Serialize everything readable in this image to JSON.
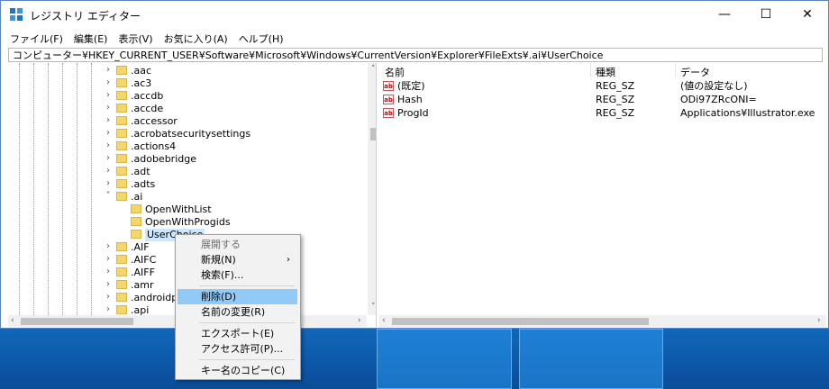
{
  "window": {
    "title": "レジストリ エディター",
    "minimize": "—",
    "maximize": "☐",
    "close": "✕"
  },
  "menu": [
    "ファイル(F)",
    "編集(E)",
    "表示(V)",
    "お気に入り(A)",
    "ヘルプ(H)"
  ],
  "address": "コンピューター¥HKEY_CURRENT_USER¥Software¥Microsoft¥Windows¥CurrentVersion¥Explorer¥FileExts¥.ai¥UserChoice",
  "tree": [
    {
      "label": ".aac",
      "level": 0,
      "chev": "›"
    },
    {
      "label": ".ac3",
      "level": 0,
      "chev": "›"
    },
    {
      "label": ".accdb",
      "level": 0,
      "chev": "›"
    },
    {
      "label": ".accde",
      "level": 0,
      "chev": "›"
    },
    {
      "label": ".accessor",
      "level": 0,
      "chev": "›"
    },
    {
      "label": ".acrobatsecuritysettings",
      "level": 0,
      "chev": "›"
    },
    {
      "label": ".actions4",
      "level": 0,
      "chev": "›"
    },
    {
      "label": ".adobebridge",
      "level": 0,
      "chev": "›"
    },
    {
      "label": ".adt",
      "level": 0,
      "chev": "›"
    },
    {
      "label": ".adts",
      "level": 0,
      "chev": "›"
    },
    {
      "label": ".ai",
      "level": 0,
      "chev": "˅"
    },
    {
      "label": "OpenWithList",
      "level": 1,
      "chev": ""
    },
    {
      "label": "OpenWithProgids",
      "level": 1,
      "chev": ""
    },
    {
      "label": "UserChoice",
      "level": 1,
      "chev": "",
      "selected": true
    },
    {
      "label": ".AIF",
      "level": 0,
      "chev": "›"
    },
    {
      "label": ".AIFC",
      "level": 0,
      "chev": "›"
    },
    {
      "label": ".AIFF",
      "level": 0,
      "chev": "›"
    },
    {
      "label": ".amr",
      "level": 0,
      "chev": "›"
    },
    {
      "label": ".androidproj",
      "level": 0,
      "chev": "›"
    },
    {
      "label": ".api",
      "level": 0,
      "chev": "›"
    }
  ],
  "list": {
    "headers": {
      "name": "名前",
      "type": "種類",
      "data": "データ"
    },
    "rows": [
      {
        "name": "(既定)",
        "type": "REG_SZ",
        "data": "(値の設定なし)"
      },
      {
        "name": "Hash",
        "type": "REG_SZ",
        "data": "ODi97ZRcONI="
      },
      {
        "name": "ProgId",
        "type": "REG_SZ",
        "data": "Applications¥Illustrator.exe"
      }
    ],
    "icon_text": "ab"
  },
  "context_menu": [
    {
      "label": "展開する",
      "state": "disabled"
    },
    {
      "label": "新規(N)",
      "state": "normal",
      "submenu": "›"
    },
    {
      "label": "検索(F)...",
      "state": "normal"
    },
    {
      "sep": true
    },
    {
      "label": "削除(D)",
      "state": "hover"
    },
    {
      "label": "名前の変更(R)",
      "state": "normal"
    },
    {
      "sep": true
    },
    {
      "label": "エクスポート(E)",
      "state": "normal"
    },
    {
      "label": "アクセス許可(P)...",
      "state": "normal"
    },
    {
      "sep": true
    },
    {
      "label": "キー名のコピー(C)",
      "state": "normal"
    }
  ],
  "colors": {
    "hover": "#91c9f7",
    "selected": "#cce8ff",
    "folder": "#f6d66b"
  }
}
